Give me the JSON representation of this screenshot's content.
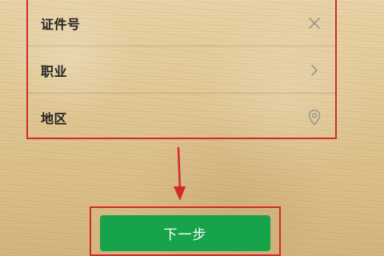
{
  "form": {
    "rows": [
      {
        "label": "证件号",
        "icon": "close-icon"
      },
      {
        "label": "职业",
        "icon": "chevron-right-icon"
      },
      {
        "label": "地区",
        "icon": "location-pin-icon"
      }
    ]
  },
  "next_button": {
    "label": "下一步"
  },
  "colors": {
    "highlight_red": "#d12a2a",
    "button_green": "#17a34a",
    "icon_gray": "#9a9590"
  }
}
